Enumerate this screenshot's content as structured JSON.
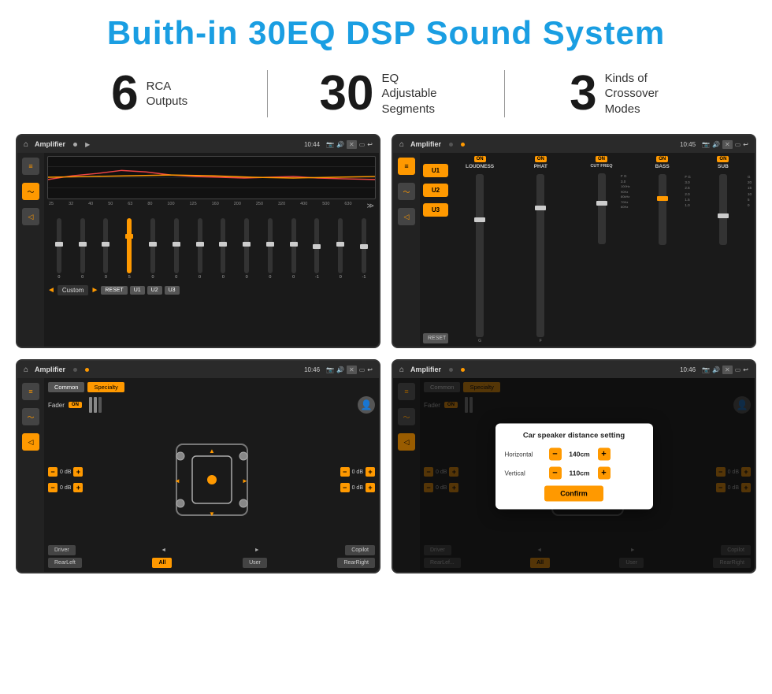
{
  "header": {
    "title": "Buith-in 30EQ DSP Sound System"
  },
  "stats": [
    {
      "number": "6",
      "label_line1": "RCA",
      "label_line2": "Outputs"
    },
    {
      "number": "30",
      "label_line1": "EQ Adjustable",
      "label_line2": "Segments"
    },
    {
      "number": "3",
      "label_line1": "Kinds of",
      "label_line2": "Crossover Modes"
    }
  ],
  "screen1": {
    "topbar": {
      "title": "Amplifier",
      "time": "10:44"
    },
    "eq_freqs": [
      "25",
      "32",
      "40",
      "50",
      "63",
      "80",
      "100",
      "125",
      "160",
      "200",
      "250",
      "320",
      "400",
      "500",
      "630"
    ],
    "eq_values": [
      "0",
      "0",
      "0",
      "5",
      "0",
      "0",
      "0",
      "0",
      "0",
      "0",
      "0",
      "-1",
      "0",
      "-1"
    ],
    "buttons": [
      "Custom",
      "RESET",
      "U1",
      "U2",
      "U3"
    ]
  },
  "screen2": {
    "topbar": {
      "title": "Amplifier",
      "time": "10:45"
    },
    "u_buttons": [
      "U1",
      "U2",
      "U3"
    ],
    "channels": [
      {
        "name": "LOUDNESS",
        "on": true
      },
      {
        "name": "PHAT",
        "on": true
      },
      {
        "name": "CUT FREQ",
        "on": true
      },
      {
        "name": "BASS",
        "on": true
      },
      {
        "name": "SUB",
        "on": true
      }
    ],
    "reset_btn": "RESET"
  },
  "screen3": {
    "topbar": {
      "title": "Amplifier",
      "time": "10:46"
    },
    "tabs": [
      "Common",
      "Specialty"
    ],
    "fader_label": "Fader",
    "fader_on": "ON",
    "db_rows": [
      "0 dB",
      "0 dB",
      "0 dB",
      "0 dB"
    ],
    "buttons": {
      "driver": "Driver",
      "copilot": "Copilot",
      "rearleft": "RearLeft",
      "all": "All",
      "user": "User",
      "rearright": "RearRight"
    }
  },
  "screen4": {
    "topbar": {
      "title": "Amplifier",
      "time": "10:46"
    },
    "tabs": [
      "Common",
      "Specialty"
    ],
    "dialog": {
      "title": "Car speaker distance setting",
      "horizontal_label": "Horizontal",
      "horizontal_value": "140cm",
      "vertical_label": "Vertical",
      "vertical_value": "110cm",
      "confirm_btn": "Confirm"
    },
    "buttons": {
      "driver": "Driver",
      "copilot": "Copilot",
      "rearleft": "RearLef...",
      "all": "All",
      "user": "User",
      "rearright": "RearRight"
    },
    "db_rows": [
      "0 dB",
      "0 dB"
    ]
  }
}
